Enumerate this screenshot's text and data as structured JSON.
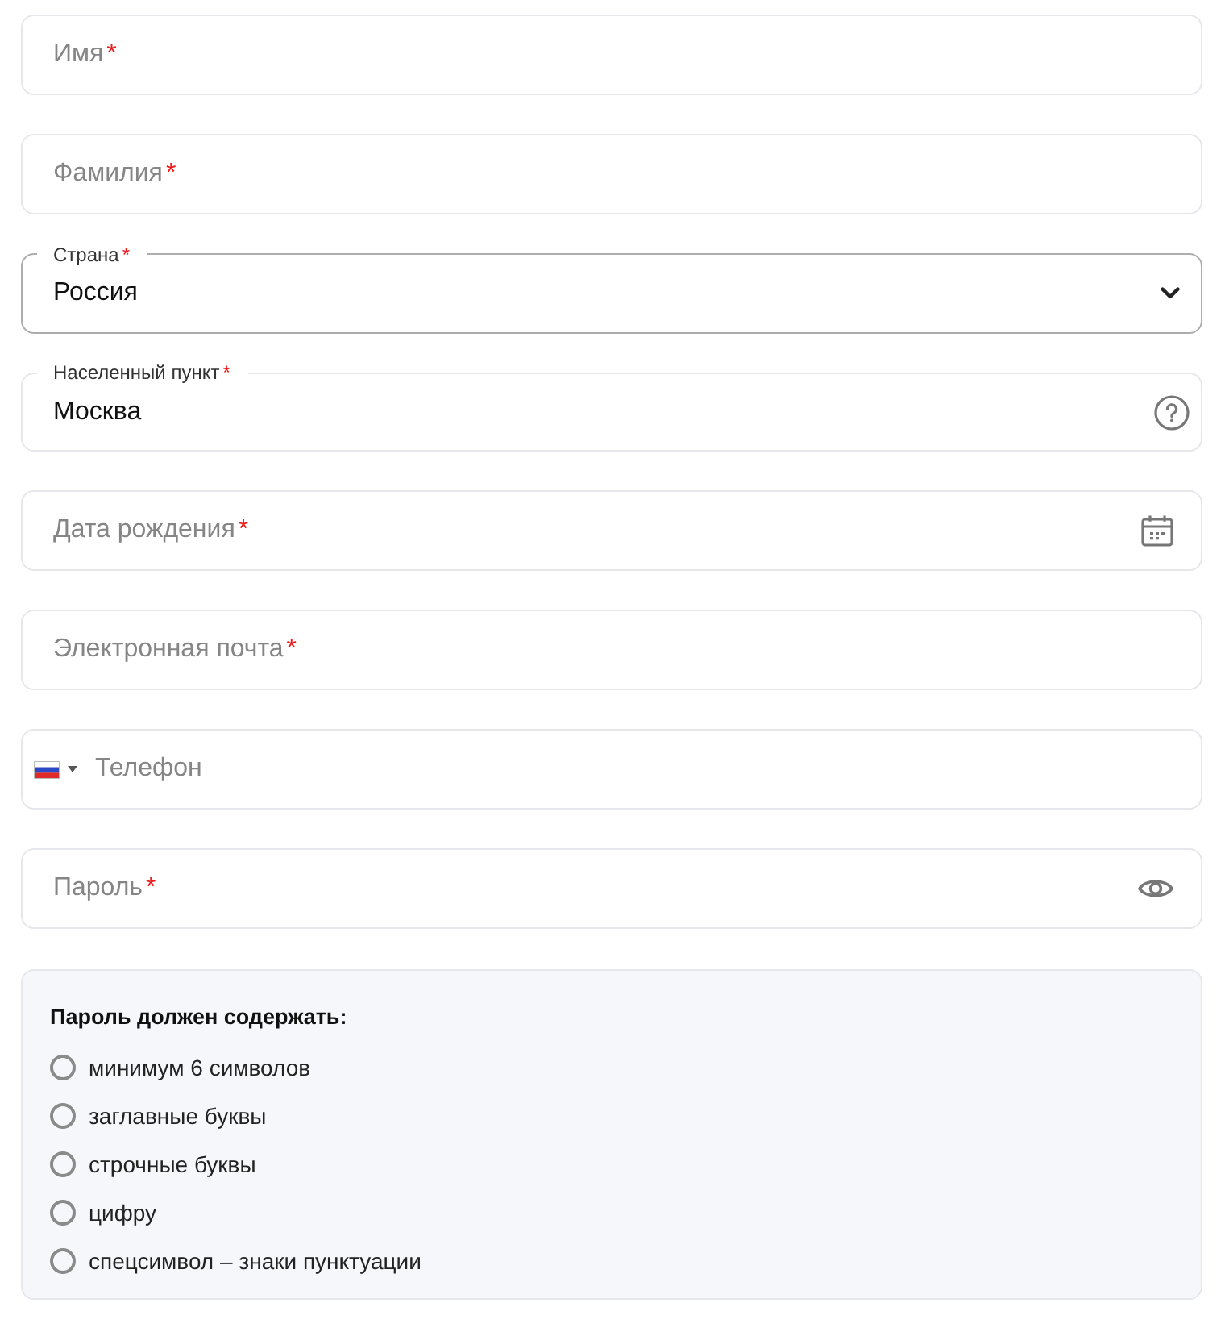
{
  "form": {
    "fields": [
      {
        "kind": "text",
        "placeholder": "Имя",
        "required_mark": "*"
      },
      {
        "kind": "text",
        "placeholder": "Фамилия",
        "required_mark": "*"
      },
      {
        "kind": "select",
        "label": "Страна",
        "required_mark": "*",
        "value": "Россия"
      },
      {
        "kind": "hint",
        "label": "Населенный пункт",
        "required_mark": "*",
        "value": "Москва"
      },
      {
        "kind": "date",
        "placeholder": "Дата рождения",
        "required_mark": "*"
      },
      {
        "kind": "email",
        "placeholder": "Электронная почта",
        "required_mark": "*"
      },
      {
        "kind": "phone",
        "placeholder": "Телефон"
      },
      {
        "kind": "password",
        "placeholder": "Пароль",
        "required_mark": "*"
      }
    ]
  },
  "password_requirements": {
    "title": "Пароль должен содержать:",
    "items": [
      {
        "text": "минимум 6 символов",
        "checked": false
      },
      {
        "text": "заглавные буквы",
        "checked": false
      },
      {
        "text": "строчные буквы",
        "checked": false
      },
      {
        "text": "цифру",
        "checked": false
      },
      {
        "text": "спецсимвол – знаки пунктуации",
        "checked": false
      }
    ]
  }
}
